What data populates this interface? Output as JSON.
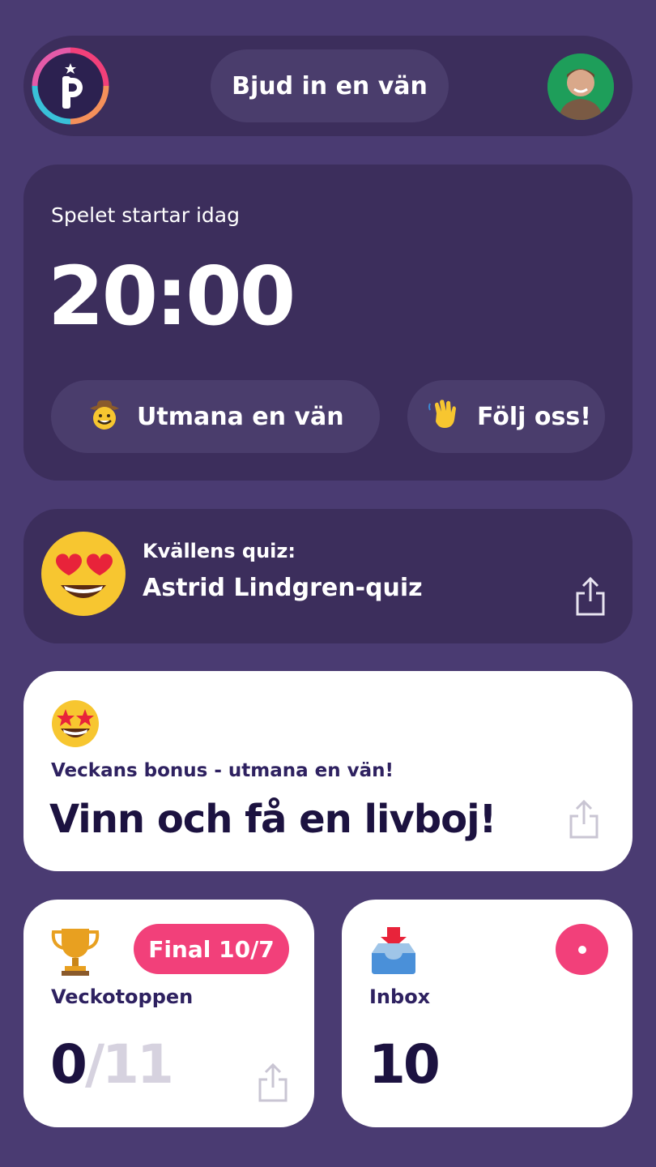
{
  "header": {
    "logo_icon": "pinglo-p-logo",
    "invite_label": "Bjud in en vän",
    "avatar_icon": "user-avatar"
  },
  "game": {
    "label": "Spelet startar idag",
    "time": "20:00",
    "challenge_label": "Utmana en vän",
    "challenge_icon": "cowboy-emoji",
    "follow_label": "Följ oss!",
    "follow_icon": "waving-hand-emoji"
  },
  "quiz": {
    "label": "Kvällens quiz:",
    "title": "Astrid Lindgren-quiz",
    "emoji_icon": "heart-eyes-emoji",
    "share_icon": "share-icon"
  },
  "bonus": {
    "label": "Veckans bonus - utmana en vän!",
    "title": "Vinn och få en livboj!",
    "emoji_icon": "star-struck-emoji",
    "share_icon": "share-icon"
  },
  "weekly": {
    "label": "Veckotoppen",
    "badge": "Final 10/7",
    "score": "0",
    "total": "/11",
    "icon": "trophy-icon"
  },
  "inbox": {
    "label": "Inbox",
    "count": "10",
    "icon": "inbox-tray-icon"
  },
  "colors": {
    "background": "#4a3b72",
    "card_dark": "#3c2e5c",
    "pill_dark": "#4a3d6c",
    "accent_pink": "#f2407a",
    "text_dark": "#1c1240"
  }
}
